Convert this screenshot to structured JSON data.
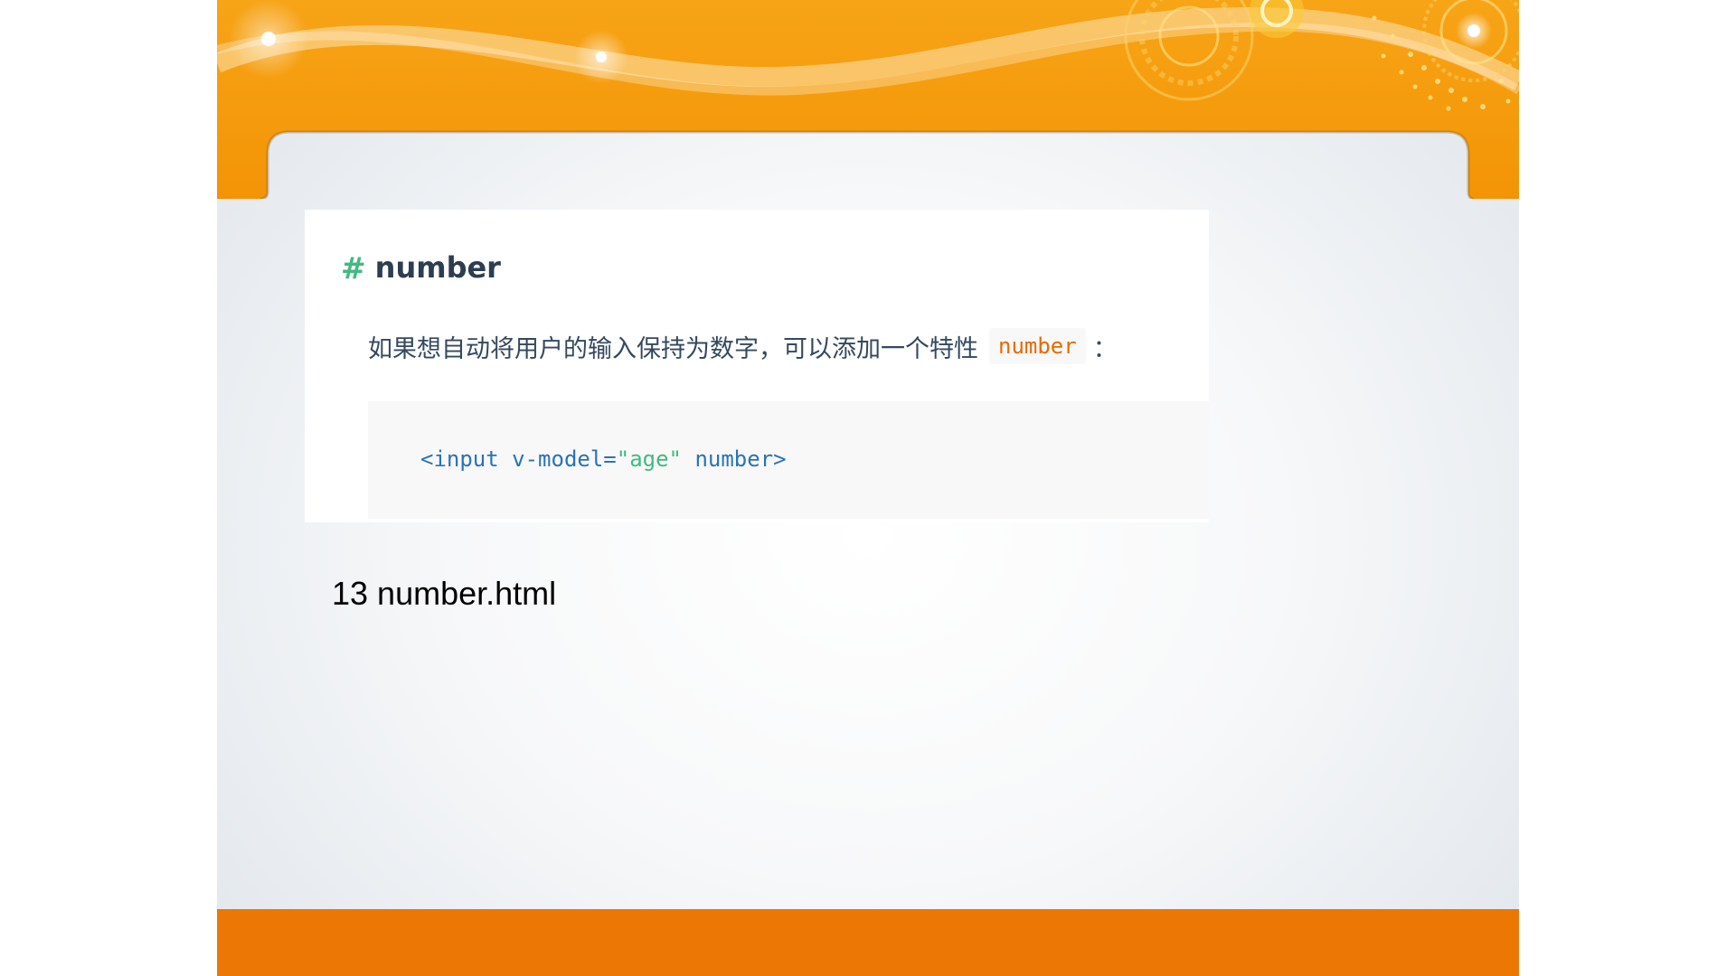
{
  "slide": {
    "section_hash": "#",
    "section_title": "number",
    "description": "如果想自动将用户的输入保持为数字，可以添加一个特性",
    "inline_code": "number",
    "description_suffix": "：",
    "code": {
      "tag_open": "<input v-model=",
      "attr_value": "\"age\"",
      "tag_close": " number>"
    },
    "caption": "13 number.html"
  },
  "colors": {
    "header_orange": "#f39b0f",
    "footer_orange": "#ec7705",
    "hash_green": "#42b983",
    "title_dark": "#2c3e50",
    "inline_code_orange": "#e96900",
    "code_blue": "#2973b7",
    "code_string_green": "#42b983"
  }
}
